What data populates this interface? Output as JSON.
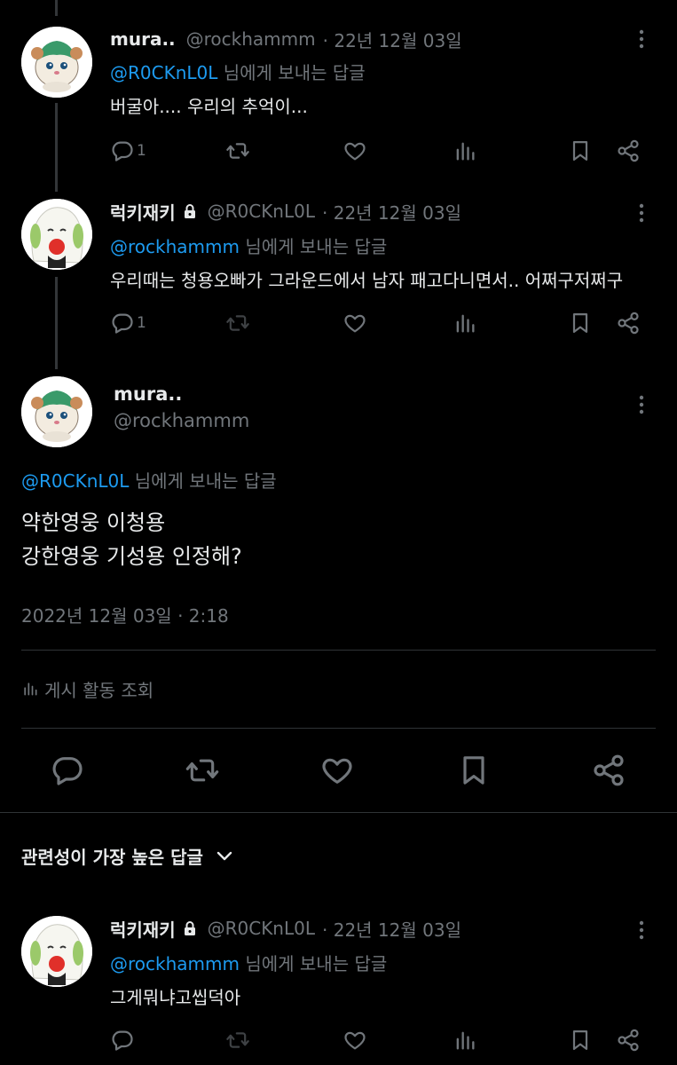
{
  "colors": {
    "background": "#000000",
    "text": "#e7e9ea",
    "muted": "#71767b",
    "link": "#1d9bf0",
    "divider": "#2f3336"
  },
  "tweets": [
    {
      "name": "mura..",
      "handle": "@rockhammm",
      "date": "· 22년 12월 03일",
      "reply_handle": "@R0CKnL0L",
      "reply_suffix": "님에게 보내는 답글",
      "text": "버굴아.... 우리의 추억이...",
      "reply_count": "1",
      "locked": false
    },
    {
      "name": "럭키재키",
      "handle": "@R0CKnL0L",
      "date": "· 22년 12월 03일",
      "reply_handle": "@rockhammm",
      "reply_suffix": "님에게 보내는 답글",
      "text": "우리때는 청용오빠가 그라운드에서 남자 패고다니면서.. 어쩌구저쩌구",
      "reply_count": "1",
      "locked": true
    }
  ],
  "main": {
    "name": "mura..",
    "handle": "@rockhammm",
    "reply_handle": "@R0CKnL0L",
    "reply_suffix": "님에게 보내는 답글",
    "text_line1": "약한영웅 이청용",
    "text_line2": "강한영웅 기성용 인정해?",
    "timestamp": "2022년 12월 03일 · 2:18",
    "activity_label": "게시 활동 조회"
  },
  "sort": {
    "label": "관련성이 가장 높은 답글"
  },
  "reply": {
    "name": "럭키재키",
    "handle": "@R0CKnL0L",
    "date": "· 22년 12월 03일",
    "reply_handle": "@rockhammm",
    "reply_suffix": "님에게 보내는 답글",
    "text": "그게뭐냐고씹덕아",
    "locked": true
  },
  "icons": [
    "reply-icon",
    "retweet-icon",
    "like-icon",
    "views-icon",
    "bookmark-icon",
    "share-icon",
    "more-icon",
    "lock-icon",
    "chevron-down-icon"
  ]
}
